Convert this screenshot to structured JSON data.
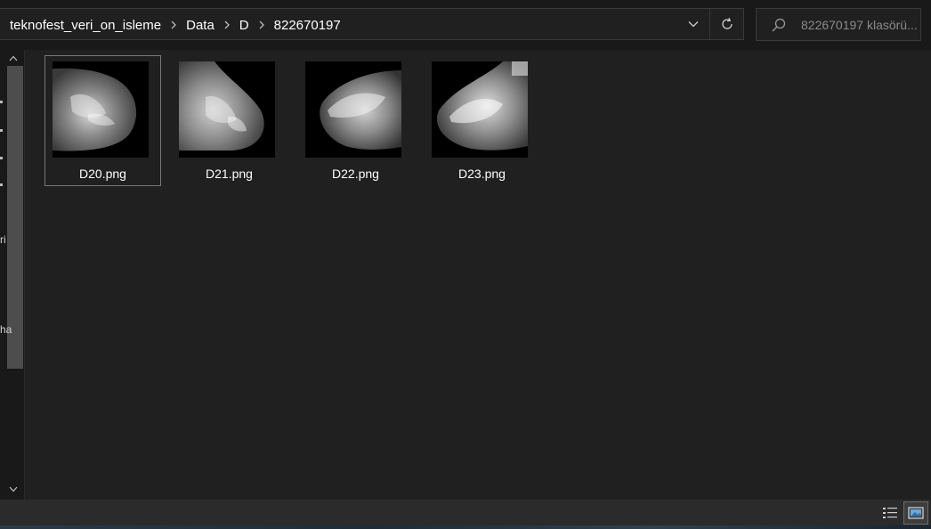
{
  "address_bar": {
    "breadcrumbs": [
      "teknofest_veri_on_isleme",
      "Data",
      "D",
      "822670197"
    ],
    "separator_icon": "chevron-right-icon",
    "dropdown_icon": "chevron-down-icon",
    "refresh_icon": "refresh-icon"
  },
  "search": {
    "icon": "search-icon",
    "placeholder": "822670197 klasörü..."
  },
  "nav_pane": {
    "fragments": [
      "ri",
      "ha"
    ]
  },
  "files": [
    {
      "name": "D20.png",
      "selected": true
    },
    {
      "name": "D21.png",
      "selected": false
    },
    {
      "name": "D22.png",
      "selected": false
    },
    {
      "name": "D23.png",
      "selected": false
    }
  ],
  "status_bar": {
    "details_view_icon": "details-view-icon",
    "large_icons_view_icon": "large-icons-view-icon"
  },
  "colors": {
    "background": "#191919",
    "content": "#202020",
    "border": "#3a3a3a",
    "text": "#ffffff",
    "placeholder": "#8a8a8a"
  }
}
